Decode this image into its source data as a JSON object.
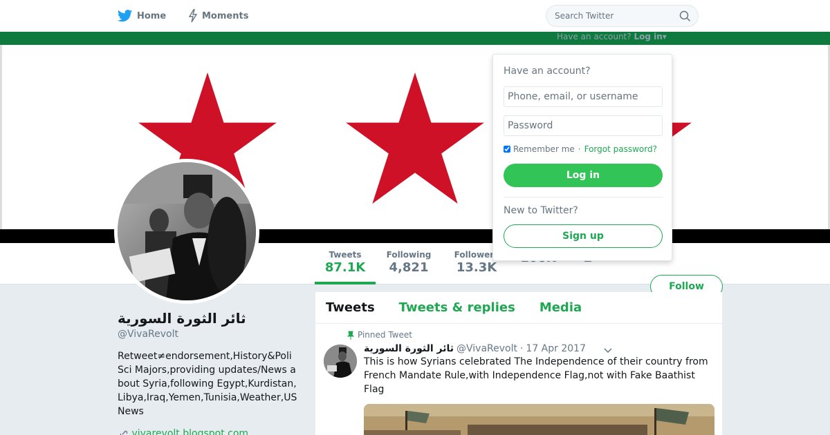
{
  "nav": {
    "home_label": "Home",
    "moments_label": "Moments",
    "home_icon": "twitter-bird-icon",
    "moments_icon": "lightning-icon"
  },
  "search": {
    "placeholder": "Search Twitter",
    "icon": "search-icon"
  },
  "login_hint": {
    "prefix": "Have an account?",
    "link": "Log in",
    "caret": "▾"
  },
  "login_dropdown": {
    "title": "Have an account?",
    "username_placeholder": "Phone, email, or username",
    "password_placeholder": "Password",
    "remember_label": "Remember me",
    "separator": "·",
    "forgot_label": "Forgot password?",
    "login_button": "Log in",
    "new_label": "New to Twitter?",
    "signup_button": "Sign up"
  },
  "profile_nav": {
    "stats": [
      {
        "label": "Tweets",
        "value": "87.1K"
      },
      {
        "label": "Following",
        "value": "4,821"
      },
      {
        "label": "Followers",
        "value": "13.3K"
      },
      {
        "label": "",
        "value": "106K"
      },
      {
        "label": "",
        "value": "2"
      }
    ],
    "follow_button": "Follow"
  },
  "profile": {
    "name": "ثائر الثورة السورية",
    "handle": "@VivaRevolt",
    "bio": "Retweet≠endorsement,History&Poli Sci Majors,providing updates/News about Syria,following Egypt,Kurdistan,Libya,Iraq,Yemen,Tunisia,Weather,US News",
    "link": "vivarevolt.blogspot.com"
  },
  "timeline": {
    "tabs": [
      {
        "label": "Tweets"
      },
      {
        "label": "Tweets & replies"
      },
      {
        "label": "Media"
      }
    ],
    "pinned_label": "Pinned Tweet",
    "tweet": {
      "name": "ثائر الثورة السورية",
      "handle": "@VivaRevolt",
      "separator": "·",
      "date": "17 Apr 2017",
      "text": "This is how Syrians celebrated The Independence of their country from French Mandate Rule,with Independence Flag,not with Fake Baathist Flag"
    }
  },
  "colors": {
    "accent": "#1da851",
    "login_button": "#33c458",
    "flag_green": "#0e7a3e",
    "flag_red": "#ce1126",
    "flag_black": "#000000"
  }
}
